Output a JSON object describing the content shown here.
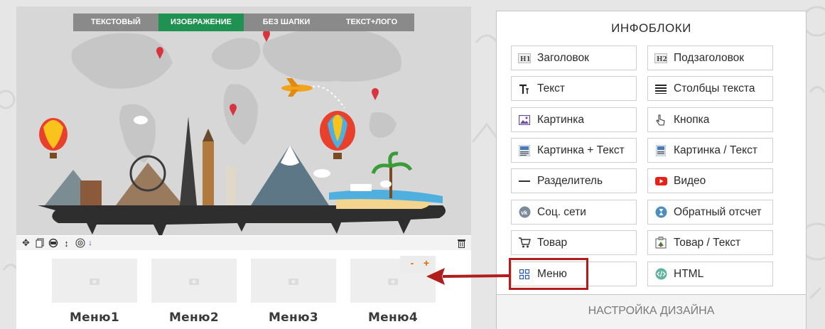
{
  "header_styles": {
    "tabs": [
      "ТЕКСТОВЫЙ",
      "ИЗОБРАЖЕНИЕ",
      "БЕЗ ШАПКИ",
      "ТЕКСТ+ЛОГО"
    ],
    "active_index": 1,
    "active_color": "#1f9151"
  },
  "block_toolbar": {
    "tools": [
      "move-icon",
      "copy-icon",
      "settings-icon",
      "resize-icon",
      "target-icon",
      "down-arrow-icon",
      "trash-icon"
    ],
    "down_arrow_label": "↓"
  },
  "menu_block": {
    "items": [
      {
        "label": "Меню1"
      },
      {
        "label": "Меню2"
      },
      {
        "label": "Меню3"
      },
      {
        "label": "Меню4"
      }
    ],
    "count_minus": "-",
    "count_plus": "+"
  },
  "infopanel": {
    "title": "ИНФОБЛОКИ",
    "buttons": [
      {
        "label": "Заголовок",
        "icon": "h1-icon"
      },
      {
        "label": "Подзаголовок",
        "icon": "h2-icon"
      },
      {
        "label": "Текст",
        "icon": "text-icon"
      },
      {
        "label": "Столбцы текста",
        "icon": "columns-icon"
      },
      {
        "label": "Картинка",
        "icon": "image-icon"
      },
      {
        "label": "Кнопка",
        "icon": "pointer-icon"
      },
      {
        "label": "Картинка + Текст",
        "icon": "image-text-icon"
      },
      {
        "label": "Картинка / Текст",
        "icon": "image-slash-text-icon"
      },
      {
        "label": "Разделитель",
        "icon": "divider-icon"
      },
      {
        "label": "Видео",
        "icon": "youtube-icon"
      },
      {
        "label": "Соц. сети",
        "icon": "vk-icon"
      },
      {
        "label": "Обратный отсчет",
        "icon": "hourglass-icon"
      },
      {
        "label": "Товар",
        "icon": "cart-icon"
      },
      {
        "label": "Товар / Текст",
        "icon": "product-text-icon"
      },
      {
        "label": "Меню",
        "icon": "grid-icon"
      },
      {
        "label": "HTML",
        "icon": "code-icon"
      }
    ],
    "design_button": "НАСТРОЙКА ДИЗАЙНА",
    "highlighted_button": "Меню",
    "highlight_color": "#b11c1c"
  }
}
